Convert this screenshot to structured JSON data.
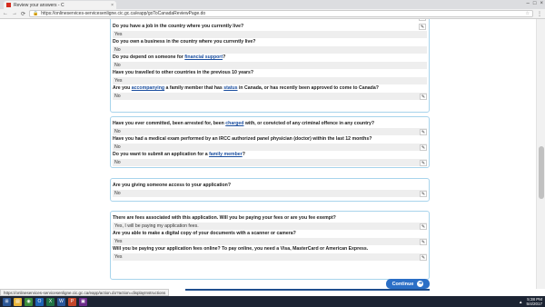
{
  "browser": {
    "tab_title": "Review your answers - C",
    "tab_close": "×",
    "url": "https://onlineservices-servicesenligne.cic.gc.ca/eapp/goToCanadaReviewPage.do",
    "back_icon": "arrow-left-icon",
    "forward_icon": "arrow-right-icon",
    "reload_icon": "reload-icon",
    "win_min": "–",
    "win_max": "□",
    "win_close": "×"
  },
  "sections": [
    {
      "items": [
        {
          "q_parts": [
            "Do you have a job in the country where you currently live?"
          ],
          "a": "Yes"
        },
        {
          "q_parts": [
            "Do you own a business in the country where you currently live?"
          ],
          "a": "No"
        },
        {
          "q_parts": [
            "Do you depend on someone for ",
            "financial support",
            "?"
          ],
          "a": "No"
        },
        {
          "q_parts": [
            "Have you travelled to other countries in the previous 10 years?"
          ],
          "a": "Yes"
        },
        {
          "q_parts": [
            "Are you ",
            "accompanying",
            " a family member that has ",
            "status",
            " in Canada, or has recently been approved to come to Canada?"
          ],
          "a": "No"
        }
      ]
    },
    {
      "items": [
        {
          "q_parts": [
            "Have you ever committed, been arrested for, been ",
            "charged",
            " with, or convicted of any criminal offence in any country?"
          ],
          "a": "No"
        },
        {
          "q_parts": [
            "Have you had a medical exam performed by an IRCC authorized panel physician (doctor) within the last 12 months?"
          ],
          "a": "No"
        },
        {
          "q_parts": [
            "Do you want to submit an application for a ",
            "family member",
            "?"
          ],
          "a": "No"
        }
      ]
    },
    {
      "items": [
        {
          "q_parts": [
            "Are you giving someone access to your application?"
          ],
          "a": "No"
        }
      ]
    },
    {
      "items": [
        {
          "q_parts": [
            "There are fees associated with this application. Will you be paying your fees or are you fee exempt?"
          ],
          "a": "Yes, I will be paying my application fees."
        },
        {
          "q_parts": [
            "Are you able to make a digital copy of your documents with a scanner or camera?"
          ],
          "a": "Yes"
        },
        {
          "q_parts": [
            "Will you be paying your application fees online?  To pay online, you need a Visa, MasterCard or American Express."
          ],
          "a": "Yes"
        }
      ]
    }
  ],
  "continue_label": "Continue",
  "status_url": "https://onlineservices-servicesenligne.cic.gc.ca/eapp/action.do?action=displayInstructions",
  "taskbar": {
    "time": "5:38 PM",
    "date": "5/4/2017"
  }
}
